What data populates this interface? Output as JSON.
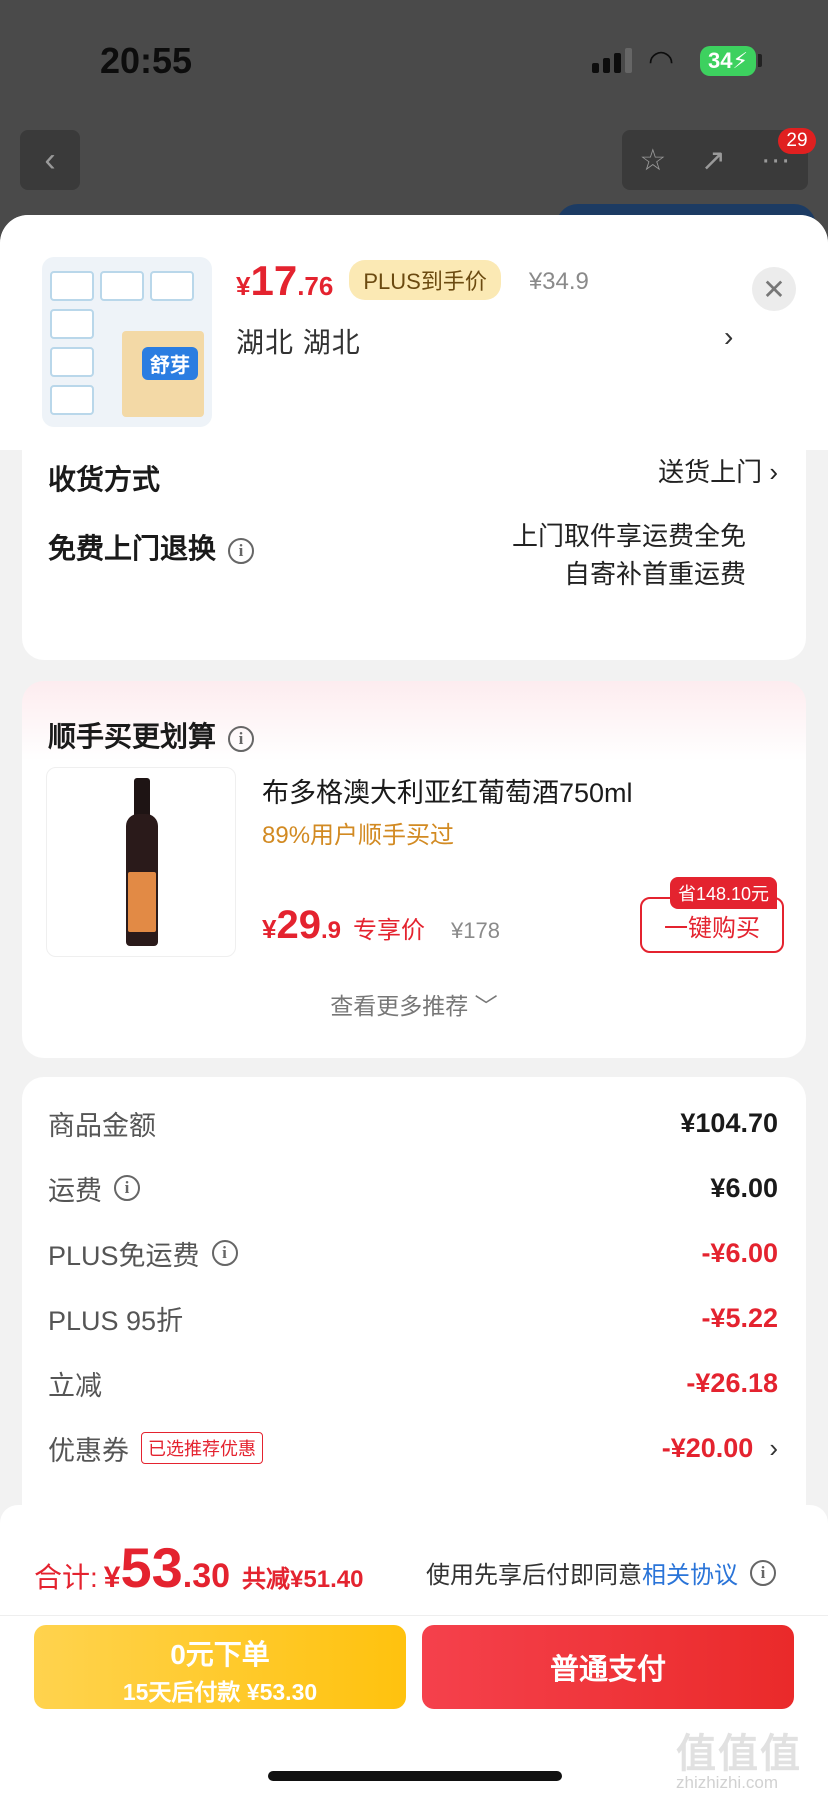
{
  "status_bar": {
    "time": "20:55",
    "battery": "34"
  },
  "nav": {
    "back_icon": "‹",
    "badge_count": "29"
  },
  "header": {
    "price_yen": "¥",
    "price_int": "17",
    "price_dec": ".76",
    "plus_tag": "PLUS到手价",
    "original_price": "¥34.9",
    "address": "湖北  湖北",
    "address_arrow": "›",
    "close_icon": "✕",
    "thumb_brand": "舒芽"
  },
  "delivery": {
    "method_label": "收货方式",
    "method_value": "送货上门",
    "return_label": "免费上门退换",
    "return_value_line1": "上门取件享运费全免",
    "return_value_line2": "自寄补首重运费"
  },
  "recommend": {
    "title": "顺手买更划算",
    "product_name": "布多格澳大利亚红葡萄酒750ml",
    "stat": "89%用户顺手买过",
    "price_yen": "¥",
    "price_int": "29",
    "price_dec": ".9",
    "price_tag": "专享价",
    "original_price": "¥178",
    "save_badge": "省148.10元",
    "buy_button": "一键购买",
    "more_label": "查看更多推荐 ﹀"
  },
  "fees": [
    {
      "label": "商品金额",
      "value": "¥104.70",
      "red": false,
      "info": false
    },
    {
      "label": "运费",
      "value": "¥6.00",
      "red": false,
      "info": true
    },
    {
      "label": "PLUS免运费",
      "value": "-¥6.00",
      "red": true,
      "info": true
    },
    {
      "label": "PLUS 95折",
      "value": "-¥5.22",
      "red": true,
      "info": false
    },
    {
      "label": "立减",
      "value": "-¥26.18",
      "red": true,
      "info": false
    },
    {
      "label": "优惠券",
      "value": "-¥20.00",
      "red": true,
      "info": false,
      "tag": "已选推荐优惠"
    }
  ],
  "footer": {
    "total_label": "合计:",
    "total_yen": "¥",
    "total_int": "53",
    "total_dec": ".30",
    "total_save": "共减¥51.40",
    "agree_prefix": "使用先享后付即同意",
    "agree_link": "相关协议",
    "later_line1": "0元下单",
    "later_line2": "15天后付款 ¥53.30",
    "pay_button": "普通支付"
  },
  "watermark": {
    "main": "值值值",
    "sub": "zhizhizhi.com"
  },
  "colors": {
    "accent_red": "#e4232f",
    "plus_gold": "#ffc20e",
    "link_blue": "#2a74d8"
  }
}
